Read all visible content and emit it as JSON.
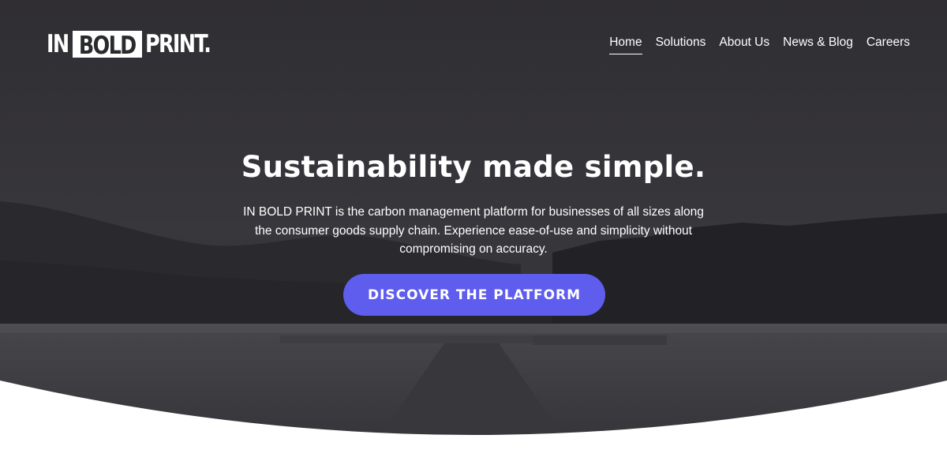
{
  "header": {
    "logo": {
      "word1": "IN",
      "word2": "BOLD",
      "word3": "PRINT."
    },
    "nav": [
      {
        "label": "Home",
        "active": true
      },
      {
        "label": "Solutions",
        "active": false
      },
      {
        "label": "About Us",
        "active": false
      },
      {
        "label": "News & Blog",
        "active": false
      },
      {
        "label": "Careers",
        "active": false
      }
    ]
  },
  "hero": {
    "headline": "Sustainability made simple.",
    "subtext": "IN BOLD PRINT is the carbon management platform for businesses of all sizes along the consumer goods supply chain. Experience ease-of-use and simplicity without compromising on accuracy.",
    "cta_label": "DISCOVER THE PLATFORM"
  },
  "colors": {
    "overlay": "#2e2d32",
    "accent": "#5f5ded",
    "text": "#ffffff",
    "page_bg": "#ffffff"
  }
}
